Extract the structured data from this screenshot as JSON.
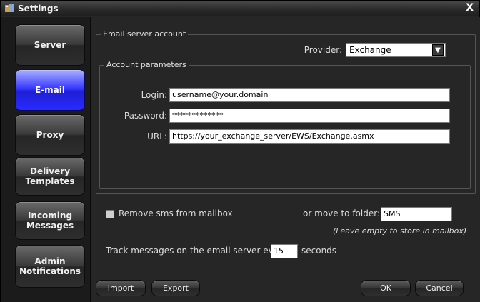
{
  "window": {
    "title": "Settings",
    "close_label": "X"
  },
  "nav": {
    "items": [
      {
        "label": "Server",
        "active": false
      },
      {
        "label": "E-mail",
        "active": true
      },
      {
        "label": "Proxy",
        "active": false
      },
      {
        "label": "Delivery\nTemplates",
        "active": false
      },
      {
        "label": "Incoming\nMessages",
        "active": false
      },
      {
        "label": "Admin\nNotifications",
        "active": false
      }
    ]
  },
  "email_account": {
    "group_label": "Email server account",
    "provider_label": "Provider:",
    "provider_value": "Exchange",
    "params": {
      "group_label": "Account parameters",
      "login_label": "Login:",
      "login_value": "username@your.domain",
      "password_label": "Password:",
      "password_value": "*************",
      "url_label": "URL:",
      "url_value": "https://your_exchange_server/EWS/Exchange.asmx"
    }
  },
  "options": {
    "remove_sms_label": "Remove sms from mailbox",
    "remove_sms_checked": false,
    "move_folder_label": "or move to folder:",
    "move_folder_value": "SMS",
    "move_folder_hint": "(Leave empty to store in mailbox)",
    "track_label": "Track messages on the email server every",
    "track_value": "15",
    "track_unit": "seconds"
  },
  "buttons": {
    "import": "Import",
    "export": "Export",
    "ok": "OK",
    "cancel": "Cancel"
  },
  "colors": {
    "active_nav": "#2a2aff",
    "background": "#262626"
  }
}
